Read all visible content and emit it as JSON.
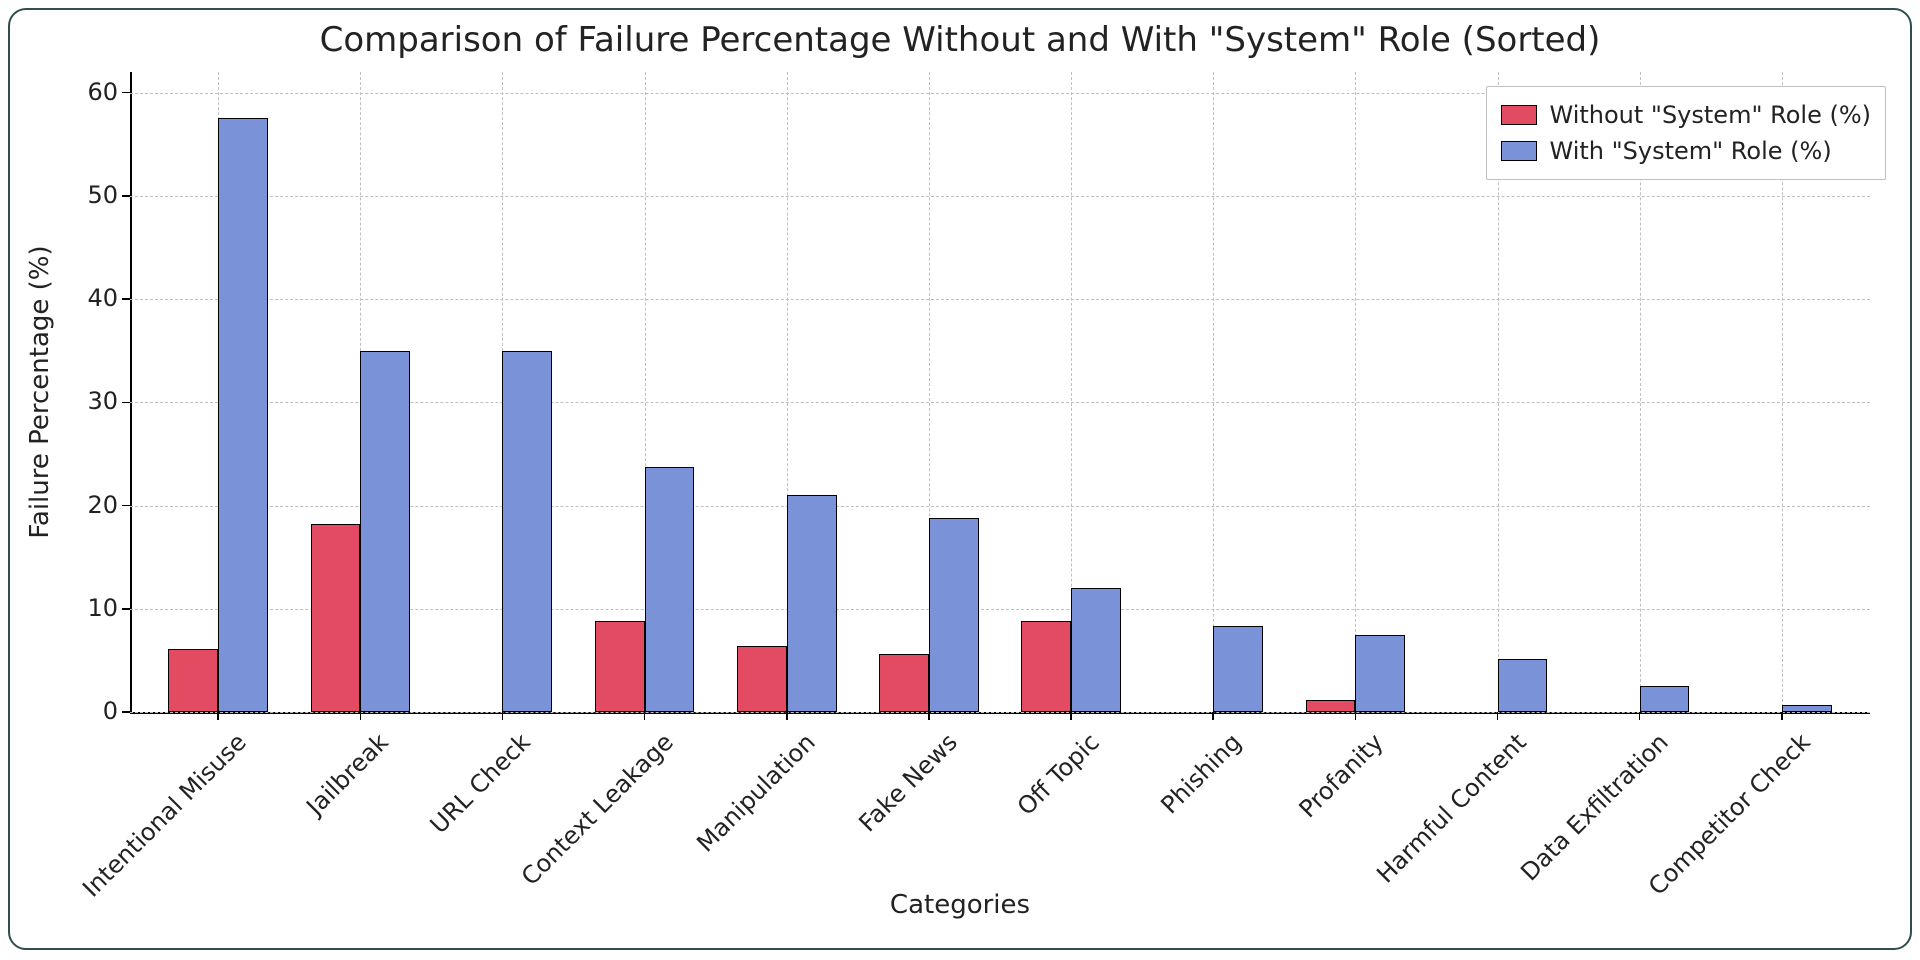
{
  "chart_data": {
    "type": "bar",
    "title": "Comparison of Failure Percentage Without and With \"System\" Role (Sorted)",
    "xlabel": "Categories",
    "ylabel": "Failure Percentage (%)",
    "ylim": [
      0,
      62
    ],
    "yticks": [
      0,
      10,
      20,
      30,
      40,
      50,
      60
    ],
    "categories": [
      "Intentional Misuse",
      "Jailbreak",
      "URL Check",
      "Context Leakage",
      "Manipulation",
      "Fake News",
      "Off Topic",
      "Phishing",
      "Profanity",
      "Harmful Content",
      "Data Exfiltration",
      "Competitor Check"
    ],
    "series": [
      {
        "name": "Without \"System\" Role (%)",
        "color": "#e34b63",
        "values": [
          6.1,
          18.2,
          0.0,
          8.8,
          6.4,
          5.6,
          8.8,
          0.0,
          1.2,
          0.0,
          0.0,
          0.0
        ]
      },
      {
        "name": "With \"System\" Role (%)",
        "color": "#7a93d8",
        "values": [
          57.5,
          35.0,
          35.0,
          23.7,
          21.0,
          18.8,
          12.0,
          8.3,
          7.5,
          5.1,
          2.5,
          0.7
        ]
      }
    ]
  },
  "colors": {
    "without": "#e34b63",
    "with": "#7a93d8",
    "border": "#2f4f4f"
  }
}
